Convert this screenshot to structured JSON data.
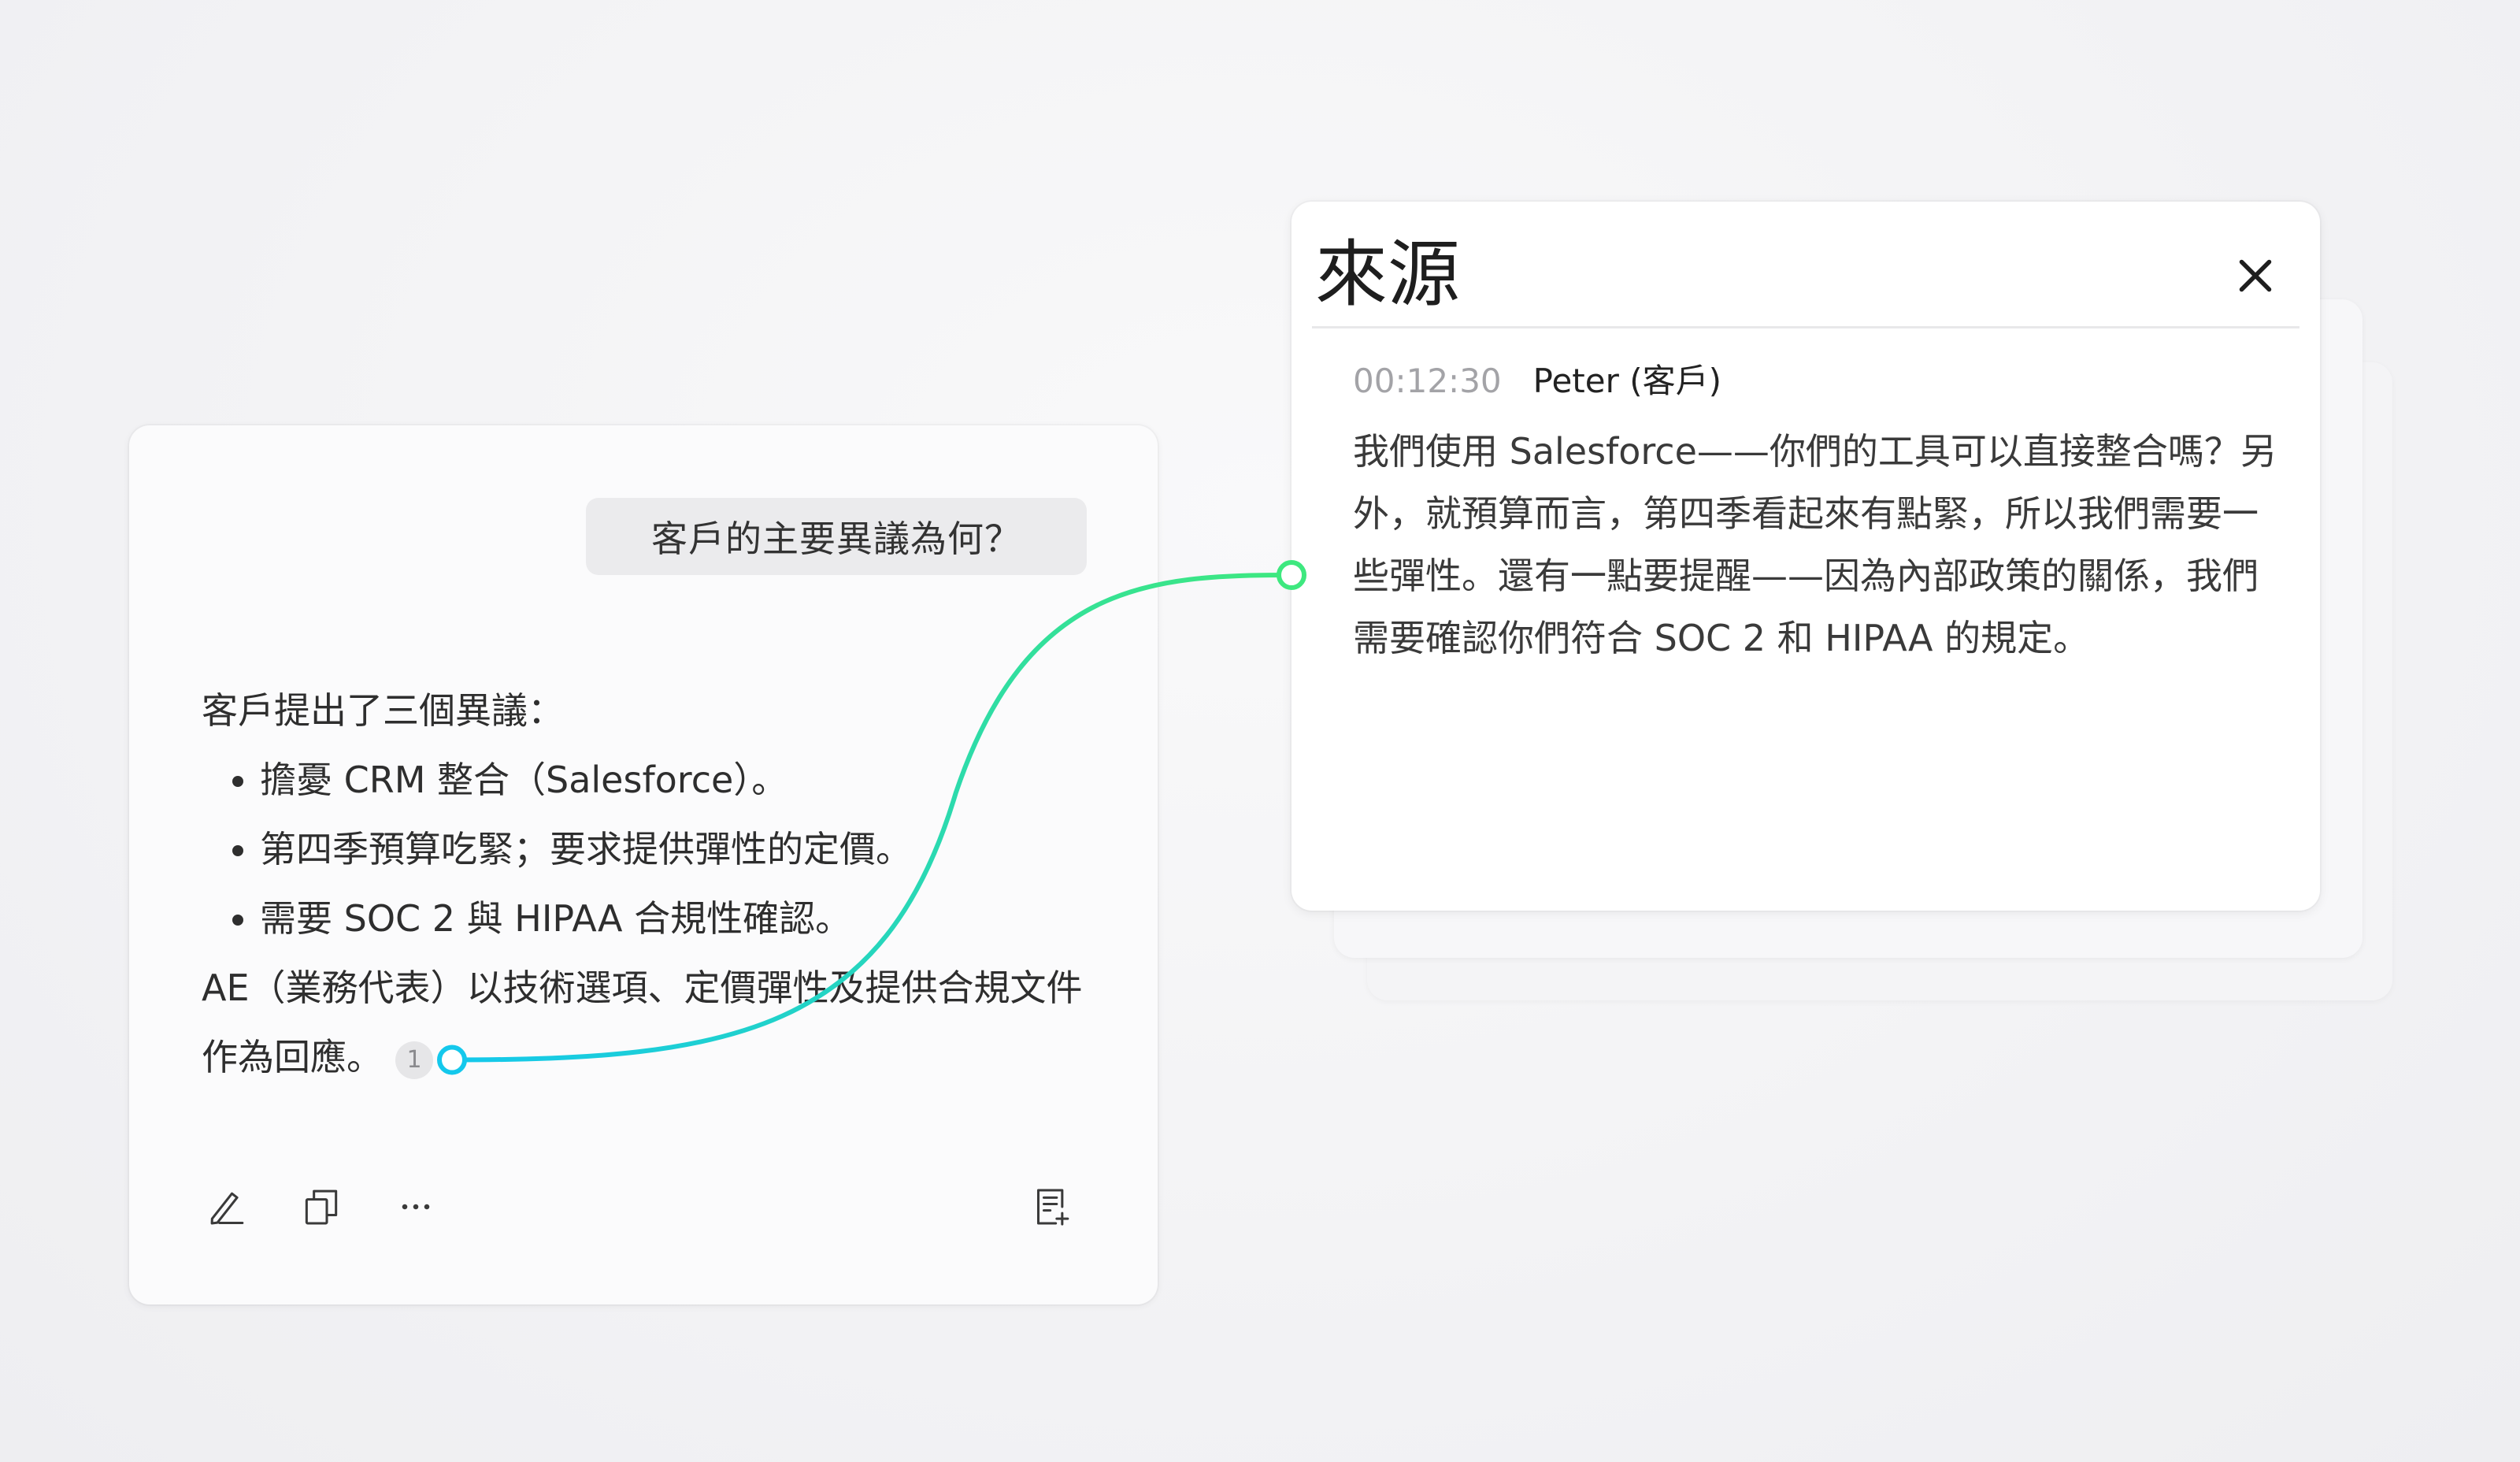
{
  "chat": {
    "question": "客戶的主要異議為何？",
    "answer_intro": "客戶提出了三個異議：",
    "bullets": [
      "擔憂 CRM 整合（Salesforce）。",
      "第四季預算吃緊；要求提供彈性的定價。",
      "需要 SOC 2 與 HIPAA 合規性確認。"
    ],
    "answer_outro": "AE（業務代表）以技術選項、定價彈性及提供合規文件作為回應。",
    "citation_number": "1",
    "toolbar": {
      "edit_icon": "pencil-icon",
      "copy_icon": "copy-icon",
      "more_icon": "more-horizontal-icon",
      "add_note_icon": "add-note-icon"
    }
  },
  "source_panel": {
    "title": "來源",
    "close_icon": "close-icon",
    "timestamp": "00:12:30",
    "speaker": "Peter (客戶)",
    "quote": "我們使用 Salesforce——你們的工具可以直接整合嗎？另外，就預算而言，第四季看起來有點緊，所以我們需要一些彈性。還有一點要提醒——因為內部政策的關係，我們需要確認你們符合 SOC 2 和 HIPAA 的規定。"
  },
  "colors": {
    "connector_start": "#14c8ec",
    "connector_end": "#3ee87f"
  }
}
